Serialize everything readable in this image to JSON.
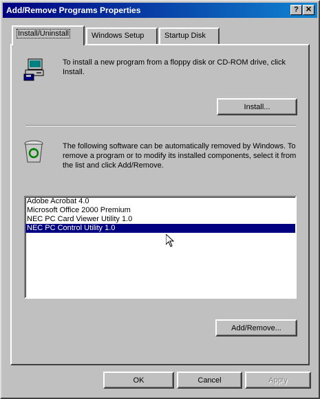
{
  "window": {
    "title": "Add/Remove Programs Properties",
    "help_glyph": "?",
    "close_glyph": "✕"
  },
  "tabs": [
    {
      "label": "Install/Uninstall",
      "active": true
    },
    {
      "label": "Windows Setup",
      "active": false
    },
    {
      "label": "Startup Disk",
      "active": false
    }
  ],
  "install_section": {
    "icon": "floppy-computer-icon",
    "description": "To install a new program from a floppy disk or CD-ROM drive, click Install.",
    "install_button": "Install..."
  },
  "remove_section": {
    "icon": "recycle-bin-icon",
    "description": "The following software can be automatically removed by Windows. To remove a program or to modify its installed components, select it from the list and click Add/Remove.",
    "programs": [
      {
        "name": "Adobe Acrobat 4.0",
        "selected": false
      },
      {
        "name": "Microsoft Office 2000 Premium",
        "selected": false
      },
      {
        "name": "NEC PC Card Viewer Utility 1.0",
        "selected": false
      },
      {
        "name": "NEC PC Control Utility 1.0",
        "selected": true
      }
    ],
    "add_remove_button": "Add/Remove..."
  },
  "footer": {
    "ok": "OK",
    "cancel": "Cancel",
    "apply": "Apply"
  },
  "colors": {
    "face": "#c0c0c0",
    "title_start": "#000080",
    "title_end": "#1084d0",
    "selection": "#000080"
  }
}
